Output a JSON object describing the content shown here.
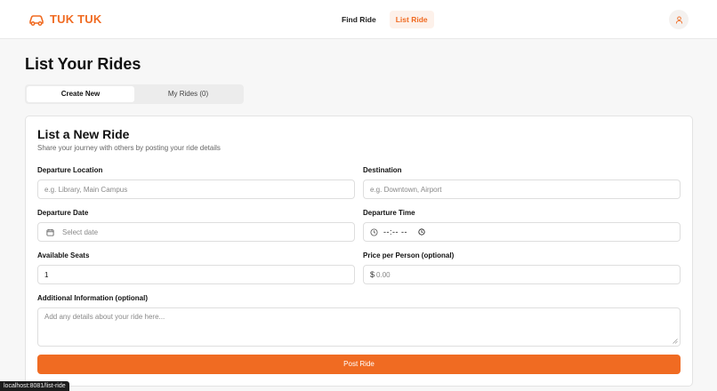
{
  "header": {
    "brand": "TUK TUK",
    "nav": [
      {
        "label": "Find Ride"
      },
      {
        "label": "List Ride"
      }
    ]
  },
  "page": {
    "title": "List Your Rides",
    "tabs": [
      {
        "label": "Create New"
      },
      {
        "label": "My Rides (0)"
      }
    ]
  },
  "form": {
    "title": "List a New Ride",
    "subtitle": "Share your journey with others by posting your ride details",
    "departure_location": {
      "label": "Departure Location",
      "placeholder": "e.g. Library, Main Campus"
    },
    "destination": {
      "label": "Destination",
      "placeholder": "e.g. Downtown, Airport"
    },
    "departure_date": {
      "label": "Departure Date",
      "placeholder": "Select date"
    },
    "departure_time": {
      "label": "Departure Time",
      "value": "--:-- --"
    },
    "available_seats": {
      "label": "Available Seats",
      "value": "1"
    },
    "price": {
      "label": "Price per Person (optional)",
      "currency": "$",
      "placeholder": "0.00"
    },
    "additional_info": {
      "label": "Additional Information (optional)",
      "placeholder": "Add any details about your ride here..."
    },
    "submit_label": "Post Ride"
  },
  "status_bar": {
    "url": "localhost:8081/list-ride"
  },
  "colors": {
    "accent": "#f06b22",
    "accent_soft": "#fdf1ea"
  },
  "icons": [
    "car-icon",
    "user-icon",
    "calendar-icon",
    "clock-icon",
    "resize-handle-icon"
  ]
}
